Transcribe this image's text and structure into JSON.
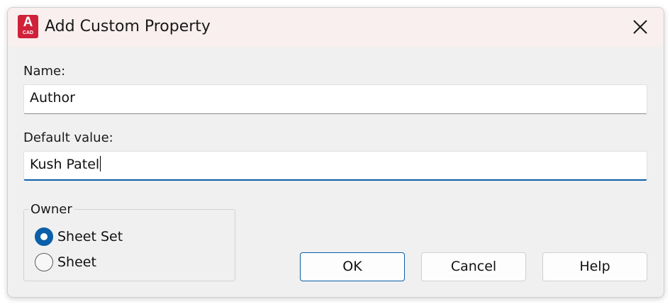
{
  "window": {
    "title": "Add Custom Property",
    "app_icon_letter": "A",
    "app_icon_sub": "CAD",
    "close_icon": "close-icon"
  },
  "fields": {
    "name_label": "Name:",
    "name_value": "Author",
    "default_label": "Default value:",
    "default_value": "Kush Patel"
  },
  "owner": {
    "legend": "Owner",
    "options": [
      {
        "label": "Sheet Set",
        "checked": true
      },
      {
        "label": "Sheet",
        "checked": false
      }
    ]
  },
  "buttons": {
    "ok": "OK",
    "cancel": "Cancel",
    "help": "Help"
  },
  "colors": {
    "accent": "#0a5fa8",
    "app_icon": "#d0213a",
    "titlebar": "#f8efee",
    "dialog_bg": "#f0f0f0"
  }
}
